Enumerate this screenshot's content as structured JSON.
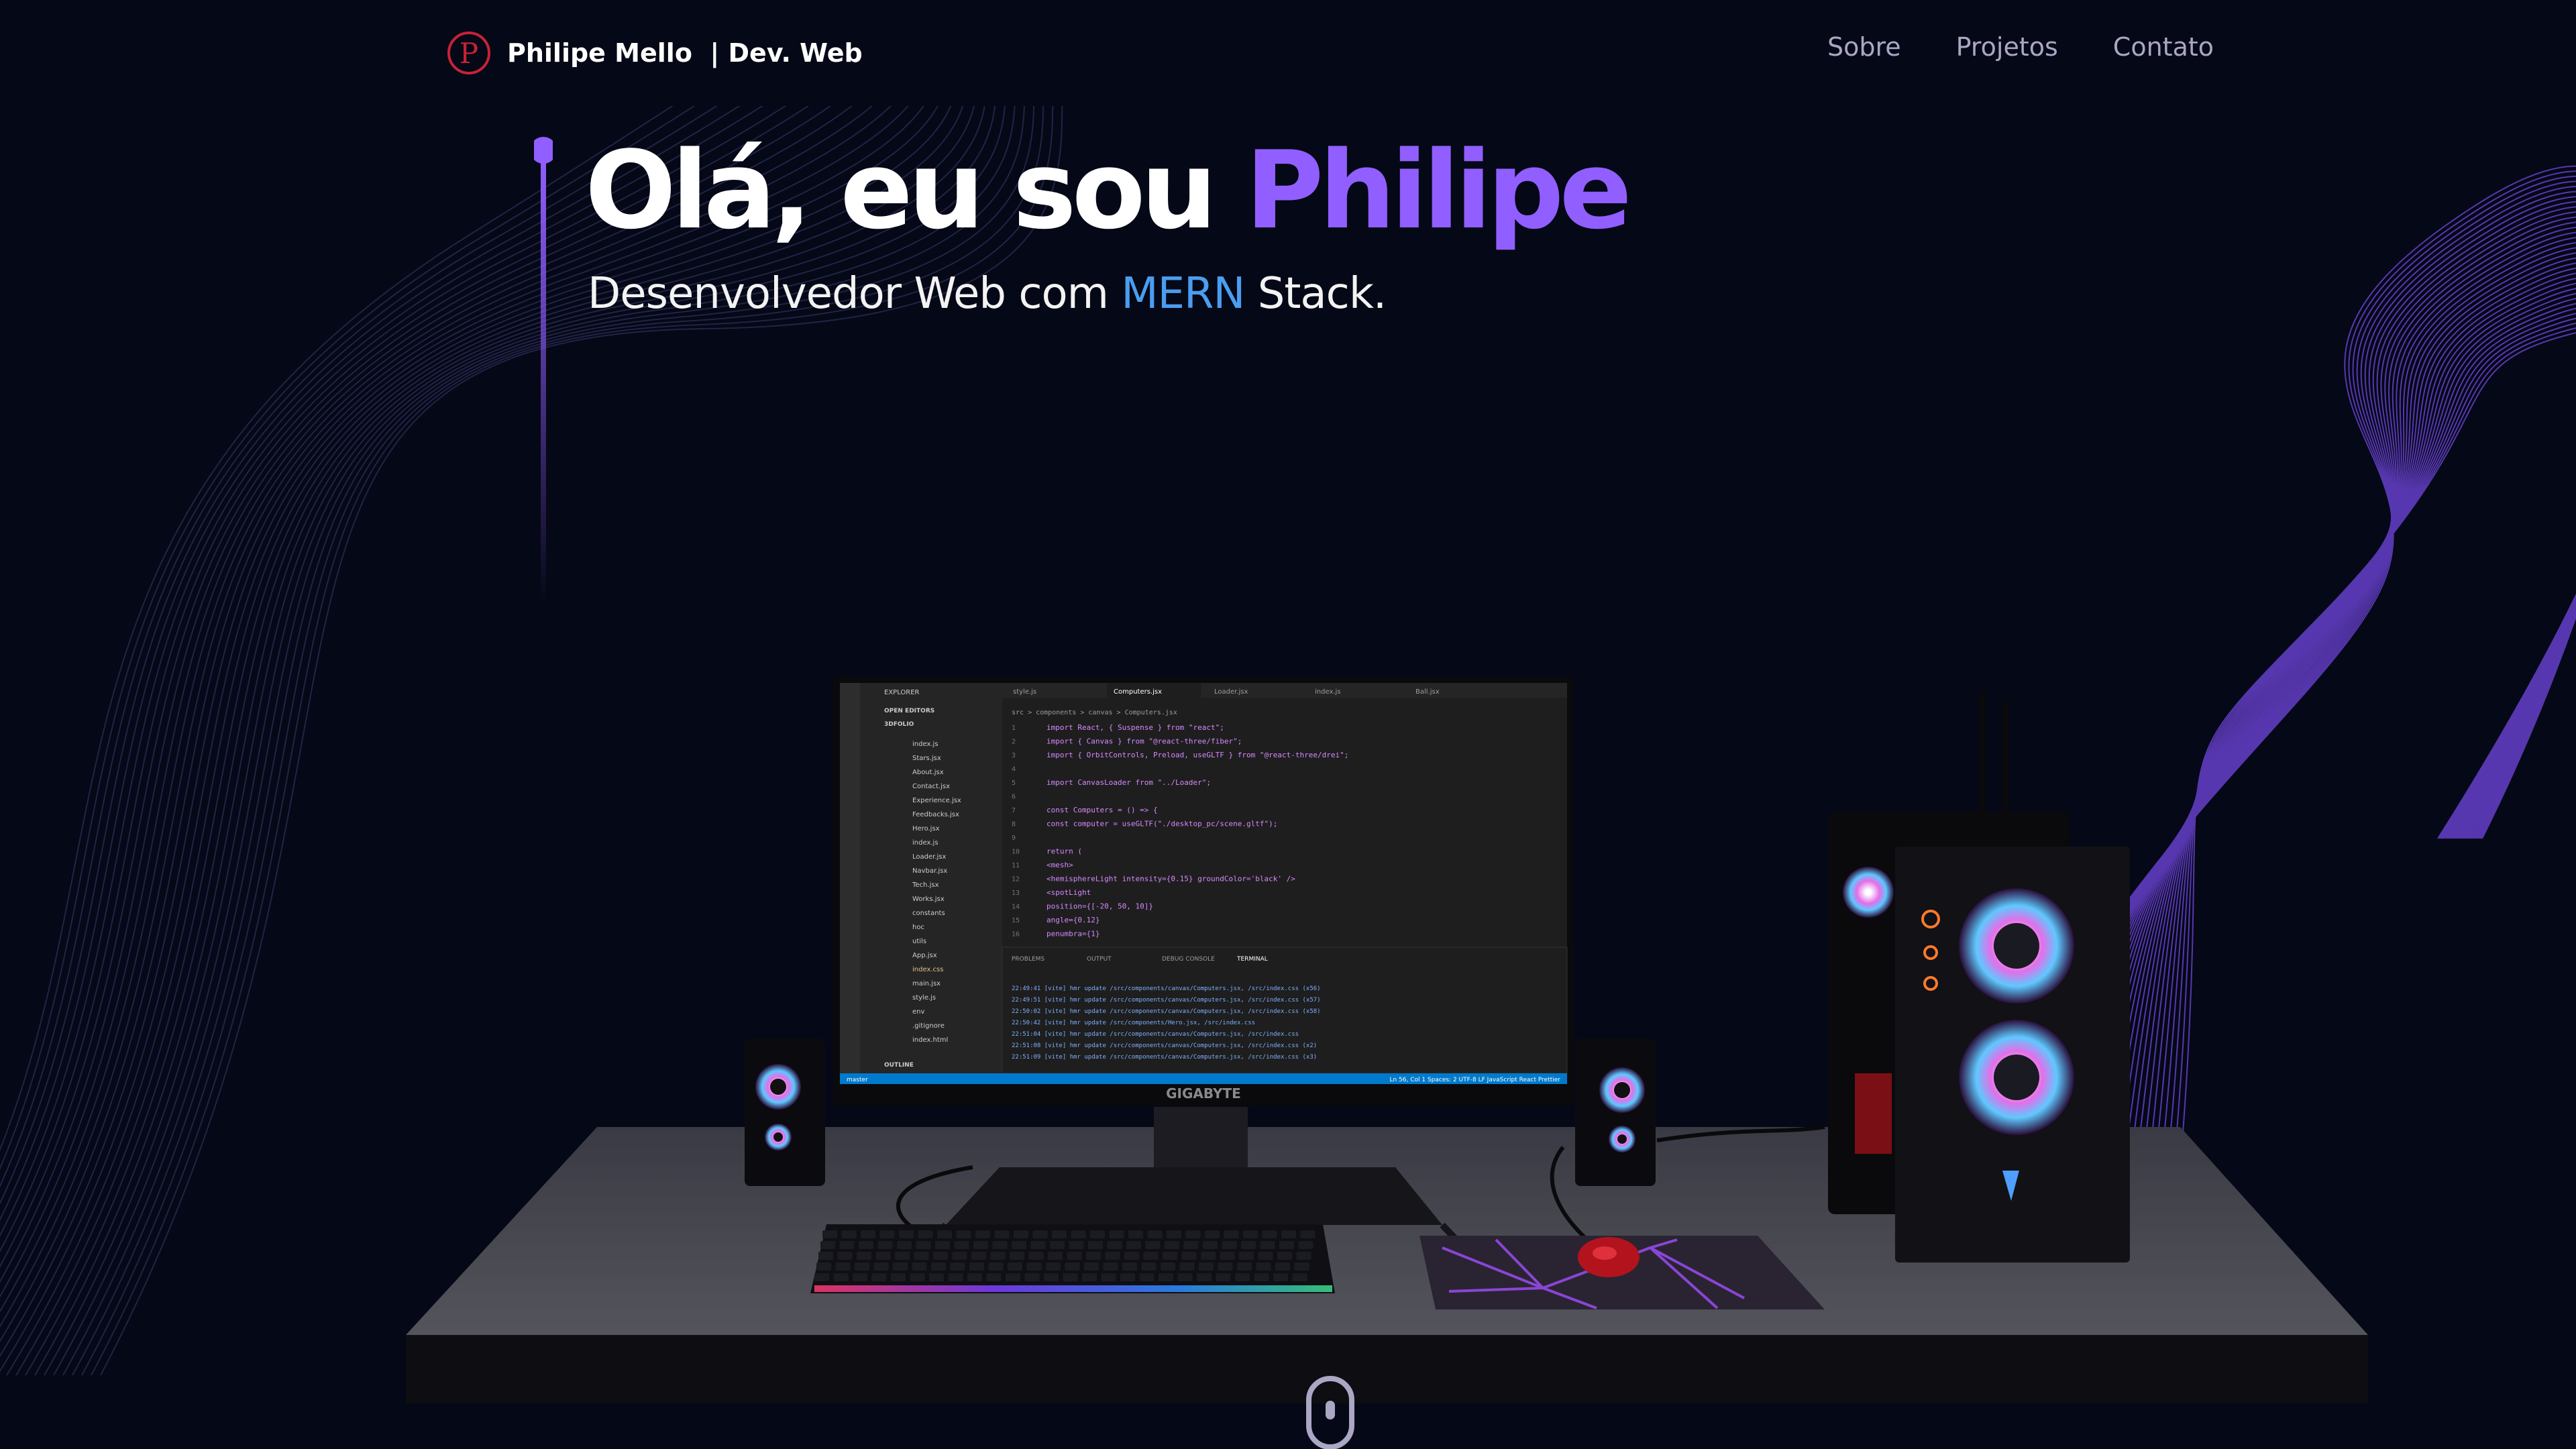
{
  "nav": {
    "logo_letter": "P",
    "brand_name": "Philipe Mello",
    "brand_suffix": "| Dev. Web",
    "links": [
      "Sobre",
      "Projetos",
      "Contato"
    ]
  },
  "hero": {
    "greeting": "Olá, eu sou",
    "name": "Philipe",
    "subtitle_before": "Desenvolvedor Web com",
    "subtitle_highlight": "MERN",
    "subtitle_after": "Stack."
  },
  "monitor": {
    "brand_label": "GIGABYTE",
    "editor": {
      "tabs": [
        "style.js",
        "Computers.jsx",
        "Loader.jsx",
        "index.js",
        "Ball.jsx"
      ],
      "breadcrumb": "src > components > canvas > Computers.jsx",
      "explorer_title": "EXPLORER",
      "open_editors": "OPEN EDITORS",
      "project": "3DFOLIO",
      "files": [
        "index.js",
        "Stars.jsx",
        "About.jsx",
        "Contact.jsx",
        "Experience.jsx",
        "Feedbacks.jsx",
        "Hero.jsx",
        "index.js",
        "Loader.jsx",
        "Navbar.jsx",
        "Tech.jsx",
        "Works.jsx",
        "constants",
        "hoc",
        "utils",
        "App.jsx",
        "index.css",
        "main.jsx",
        "style.js",
        "env",
        ".gitignore",
        "index.html"
      ],
      "outline": "OUTLINE",
      "code_lines": [
        "import React, { Suspense } from \"react\";",
        "import { Canvas } from \"@react-three/fiber\";",
        "import { OrbitControls, Preload, useGLTF } from \"@react-three/drei\";",
        "",
        "import CanvasLoader from \"../Loader\";",
        "",
        "const Computers = () => {",
        "  const computer = useGLTF(\"./desktop_pc/scene.gltf\");",
        "",
        "  return (",
        "    <mesh>",
        "      <hemisphereLight intensity={0.15} groundColor='black' />",
        "      <spotLight",
        "        position={[-20, 50, 10]}",
        "        angle={0.12}",
        "        penumbra={1}"
      ],
      "panel_tabs": [
        "PROBLEMS",
        "OUTPUT",
        "DEBUG CONSOLE",
        "TERMINAL"
      ],
      "terminal_lines": [
        "22:49:41 [vite] hmr update /src/components/canvas/Computers.jsx, /src/index.css (x56)",
        "22:49:51 [vite] hmr update /src/components/canvas/Computers.jsx, /src/index.css (x57)",
        "22:50:02 [vite] hmr update /src/components/canvas/Computers.jsx, /src/index.css (x58)",
        "22:50:42 [vite] hmr update /src/components/Hero.jsx, /src/index.css",
        "22:51:04 [vite] hmr update /src/components/canvas/Computers.jsx, /src/index.css",
        "22:51:08 [vite] hmr update /src/components/canvas/Computers.jsx, /src/index.css (x2)",
        "22:51:09 [vite] hmr update /src/components/canvas/Computers.jsx, /src/index.css (x3)"
      ],
      "status_left": "master",
      "status_right": "Ln 56, Col 1   Spaces: 2   UTF-8   LF   JavaScript React   Prettier"
    }
  },
  "colors": {
    "background": "#050816",
    "accent": "#915eff",
    "highlight": "#4a9df0",
    "nav_link": "#aaa6c3"
  },
  "icons": {
    "logo": "p-circle-logo",
    "scroll": "mouse-scroll-icon"
  }
}
